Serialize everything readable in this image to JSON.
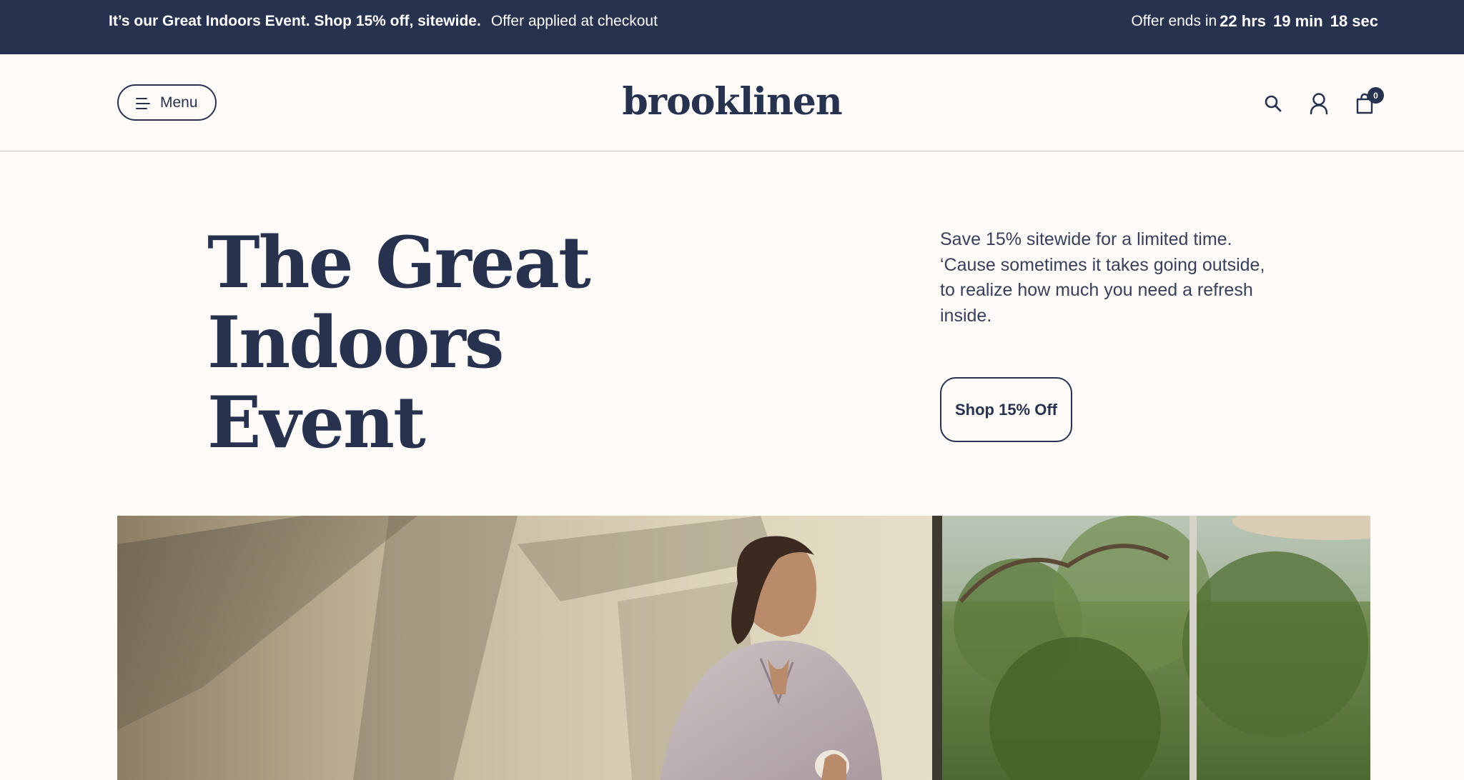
{
  "promo": {
    "headline": "It’s our Great Indoors Event. Shop 15% off, sitewide.",
    "subtext": "Offer applied at checkout",
    "countdown_prefix": "Offer ends in",
    "hours": "22 hrs",
    "minutes": "19 min",
    "seconds": "18 sec"
  },
  "header": {
    "menu_label": "Menu",
    "logo": "brooklinen",
    "cart_count": "0",
    "icons": [
      "search-icon",
      "account-icon",
      "cart-icon"
    ]
  },
  "hero": {
    "title_line1": "The Great",
    "title_line2": "Indoors Event",
    "description": "Save 15% sitewide for a limited time. ‘Cause sometimes it takes going outside, to realize how much you need a refresh inside.",
    "cta_label": "Shop 15% Off"
  },
  "colors": {
    "navy": "#27324f",
    "background": "#fdfaf7"
  }
}
